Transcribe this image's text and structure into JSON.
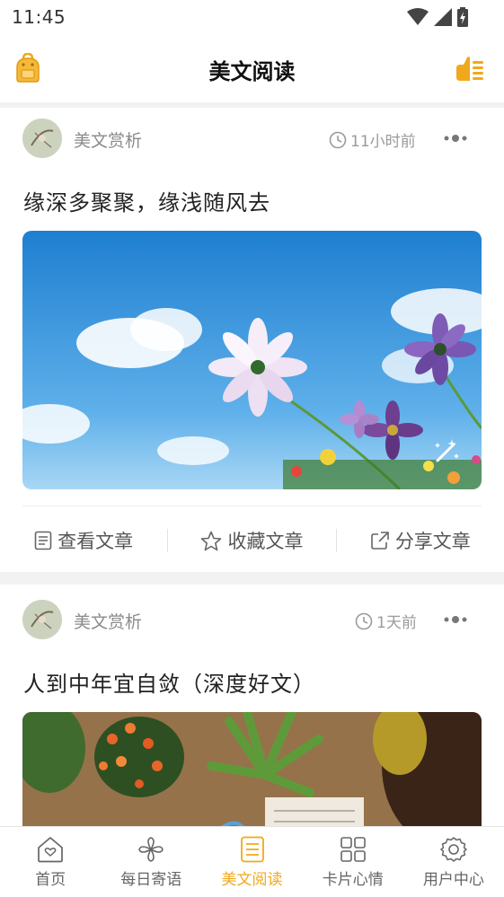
{
  "status_bar": {
    "time": "11:45"
  },
  "app_bar": {
    "title": "美文阅读"
  },
  "posts": [
    {
      "author": "美文赏析",
      "time": "11小时前",
      "title": "缘深多聚聚，缘浅随风去"
    },
    {
      "author": "美文赏析",
      "time": "1天前",
      "title": "人到中年宜自敛（深度好文）"
    }
  ],
  "actions": {
    "view": "查看文章",
    "collect": "收藏文章",
    "share": "分享文章"
  },
  "tabs": [
    {
      "label": "首页",
      "active": false
    },
    {
      "label": "每日寄语",
      "active": false
    },
    {
      "label": "美文阅读",
      "active": true
    },
    {
      "label": "卡片心情",
      "active": false
    },
    {
      "label": "用户中心",
      "active": false
    }
  ],
  "colors": {
    "accent": "#f0a91a",
    "text": "#222222",
    "muted": "#8a8a8a"
  }
}
